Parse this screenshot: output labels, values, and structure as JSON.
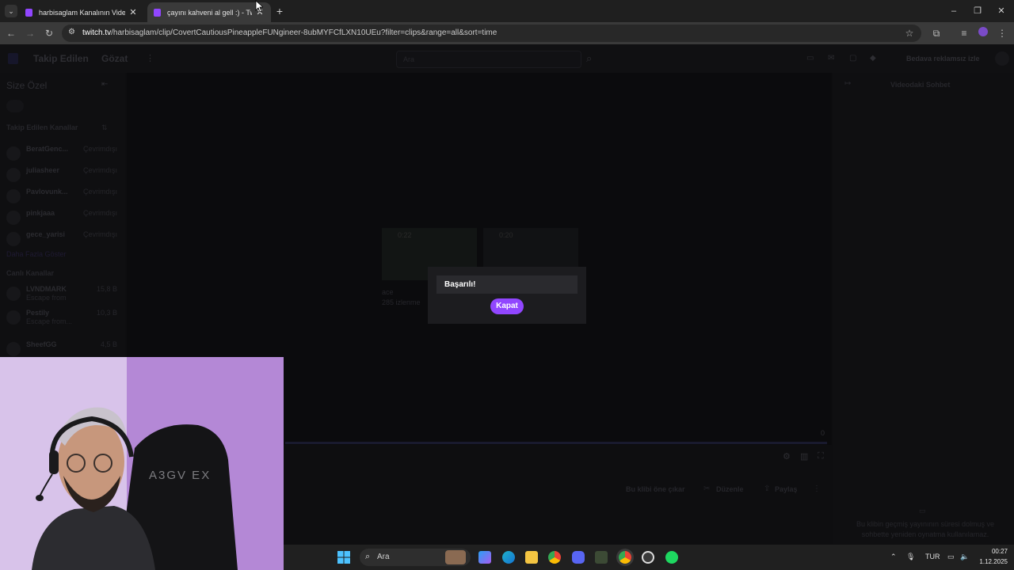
{
  "browser": {
    "tabs": [
      {
        "title": "harbisaglam Kanalının Videoları",
        "active": false
      },
      {
        "title": "çayını kahveni al gell :) - Twitch",
        "active": true
      }
    ],
    "new_tab_icon": "plus-icon",
    "url_host": "twitch.tv",
    "url_path": "/harbisaglam/clip/CovertCautiousPineappleFUNgineer-8ubMYFCfLXN10UEu?filter=clips&range=all&sort=time"
  },
  "twitch": {
    "nav": {
      "following": "Takip Edilen",
      "browse": "Gözat",
      "search_placeholder": "Ara",
      "ad_free": "Bedava reklamsız izle"
    },
    "sidebar": {
      "for_you": "Size Özel",
      "followed_header": "Takip Edilen Kanallar",
      "followed": [
        {
          "name": "BeratGenc...",
          "status": "Çevrimdışı"
        },
        {
          "name": "juliasheer",
          "status": "Çevrimdışı"
        },
        {
          "name": "Pavlovunk...",
          "status": "Çevrimdışı"
        },
        {
          "name": "pinkjaaa",
          "status": "Çevrimdışı"
        },
        {
          "name": "gece_yarisi",
          "status": "Çevrimdışı"
        }
      ],
      "show_more": "Daha Fazla Göster",
      "live_header": "Canlı Kanallar",
      "live": [
        {
          "name": "LVNDMARK",
          "game": "Escape from",
          "viewers": "15,8 B"
        },
        {
          "name": "Pestily",
          "game": "Escape from...",
          "viewers": "10,3 B"
        },
        {
          "name": "SheefGG",
          "game": "",
          "viewers": "4,5 B"
        }
      ]
    },
    "chat_title": "Videodaki Sohbet",
    "chat_notice": "Bu klibin geçmiş yayınının süresi dolmuş ve sohbette yeniden oynatma kullanılamaz.",
    "clip_actions": {
      "feature": "Bu klibi öne çıkar",
      "edit": "Düzenle",
      "share": "Paylaş"
    },
    "progress_time": "0",
    "thumb_times": [
      "0:22",
      "0:20"
    ],
    "clip_card": {
      "title": "ace",
      "views": "285 izlenme"
    }
  },
  "modal": {
    "title": "Başarılı!",
    "close_label": "Kapat"
  },
  "taskbar": {
    "search_label": "Ara",
    "lang": "TUR",
    "time": "00:27",
    "date": "1.12.2025"
  },
  "colors": {
    "twitch_purple": "#9146ff",
    "modal_bg": "#1c1c1f"
  }
}
